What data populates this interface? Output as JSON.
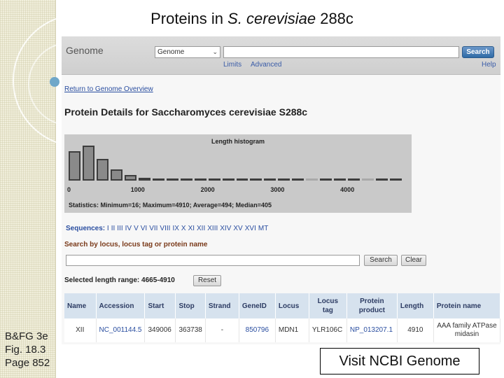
{
  "slide": {
    "title_prefix": "Proteins in ",
    "title_species": "S. cerevisiae",
    "title_suffix": " 288c",
    "reference_lines": [
      "B&FG 3e",
      "Fig. 18.3",
      "Page 852"
    ],
    "visit_box_label": "Visit NCBI Genome"
  },
  "ncbi": {
    "logo": "Genome",
    "database_select": "Genome",
    "search_value": "",
    "search_button": "Search",
    "links": {
      "limits": "Limits",
      "advanced": "Advanced",
      "help": "Help"
    },
    "return_link": "Return to Genome Overview",
    "heading": "Protein Details for Saccharomyces cerevisiae S288c"
  },
  "histogram": {
    "title": "Length histogram",
    "stats": "Statistics: Minimum=16; Maximum=4910; Average=494; Median=405",
    "tick_labels": [
      "0",
      "1000",
      "2000",
      "3000",
      "4000"
    ]
  },
  "chart_data": {
    "type": "bar",
    "title": "Length histogram",
    "xlim": [
      0,
      4910
    ],
    "bin_width": 200,
    "bin_starts": [
      0,
      200,
      400,
      600,
      800,
      1000,
      1200,
      1400,
      1600,
      1800,
      2000,
      2200,
      2400,
      2600,
      2800,
      3000,
      3200,
      3400,
      3600,
      3800,
      4000,
      4200,
      4400,
      4600
    ],
    "values": [
      0.75,
      0.9,
      0.55,
      0.28,
      0.14,
      0.07,
      0.06,
      0.05,
      0.05,
      0.04,
      0.04,
      0.04,
      0.04,
      0.03,
      0.03,
      0.03,
      0.03,
      0.03,
      0.03,
      0.03,
      0.03,
      0.03,
      0.03,
      0.03
    ],
    "highlighted": [
      false,
      false,
      false,
      false,
      false,
      false,
      false,
      false,
      false,
      false,
      false,
      false,
      false,
      false,
      false,
      false,
      false,
      true,
      false,
      false,
      false,
      true,
      false,
      false
    ],
    "stats": "Statistics: Minimum=16; Maximum=4910; Average=494; Median=405"
  },
  "sequences": {
    "label": "Sequences:",
    "items": [
      "I",
      "II",
      "III",
      "IV",
      "V",
      "VI",
      "VII",
      "VIII",
      "IX",
      "X",
      "XI",
      "XII",
      "XIII",
      "XIV",
      "XV",
      "XVI",
      "MT"
    ]
  },
  "locus_search": {
    "label": "Search by locus, locus tag or protein name",
    "value": "",
    "search_button": "Search",
    "clear_button": "Clear"
  },
  "range": {
    "text": "Selected length range: 4665-4910",
    "reset_button": "Reset"
  },
  "table": {
    "headers": [
      "Name",
      "Accession",
      "Start",
      "Stop",
      "Strand",
      "GeneID",
      "Locus",
      "Locus tag",
      "Protein product",
      "Length",
      "Protein name"
    ],
    "rows": [
      [
        "XII",
        "NC_001144.5",
        "349006",
        "363738",
        "-",
        "850796",
        "MDN1",
        "YLR106C",
        "NP_013207.1",
        "4910",
        "AAA family ATPase midasin"
      ]
    ]
  }
}
